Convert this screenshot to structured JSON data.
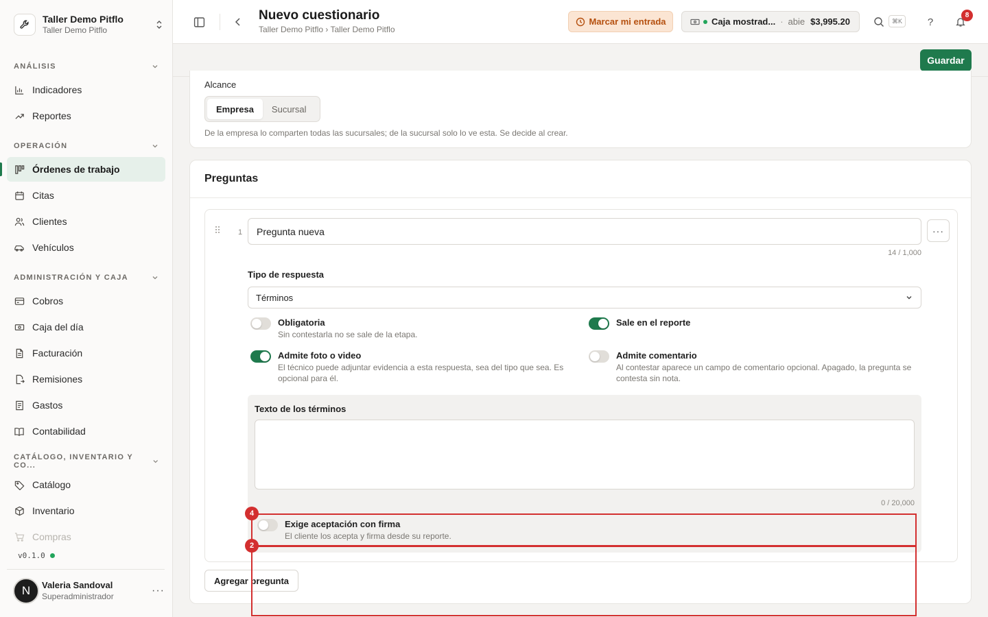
{
  "org": {
    "name": "Taller Demo Pitflo",
    "subtitle": "Taller Demo Pitflo"
  },
  "sidebar": {
    "sections": [
      {
        "title": "ANÁLISIS",
        "items": [
          "Indicadores",
          "Reportes"
        ]
      },
      {
        "title": "OPERACIÓN",
        "items": [
          "Órdenes de trabajo",
          "Citas",
          "Clientes",
          "Vehículos"
        ]
      },
      {
        "title": "ADMINISTRACIÓN Y CAJA",
        "items": [
          "Cobros",
          "Caja del día",
          "Facturación",
          "Remisiones",
          "Gastos",
          "Contabilidad"
        ]
      },
      {
        "title": "CATÁLOGO, INVENTARIO Y CO...",
        "items": [
          "Catálogo",
          "Inventario",
          "Compras"
        ]
      }
    ],
    "version": "v0.1.0"
  },
  "user": {
    "initial": "N",
    "name": "Valeria Sandoval",
    "role": "Superadministrador",
    "more": "···"
  },
  "header": {
    "title": "Nuevo cuestionario",
    "breadcrumb": "Taller Demo Pitflo › Taller Demo Pitflo",
    "checkin_label": "Marcar mi entrada",
    "cash": {
      "name": "Caja mostrad...",
      "sep": "·",
      "status": "abie",
      "amount": "$3,995.20"
    },
    "search_shortcut": "⌘K",
    "help": "?",
    "notifications_count": "8"
  },
  "actions": {
    "save_label": "Guardar"
  },
  "scope": {
    "label": "Alcance",
    "options": [
      "Empresa",
      "Sucursal"
    ],
    "selected": "Empresa",
    "help": "De la empresa lo comparten todas las sucursales; de la sucursal solo lo ve esta. Se decide al crear."
  },
  "questions": {
    "title": "Preguntas",
    "add_label": "Agregar pregunta",
    "items": [
      {
        "number": "1",
        "text": "Pregunta nueva",
        "char_count": "14 / 1,000",
        "more": "···",
        "type_label": "Tipo de respuesta",
        "type_value": "Términos",
        "options": [
          {
            "title": "Obligatoria",
            "desc": "Sin contestarla no se sale de la etapa.",
            "on": false
          },
          {
            "title": "Sale en el reporte",
            "desc": "",
            "on": true
          },
          {
            "title": "Admite foto o video",
            "desc": "El técnico puede adjuntar evidencia a esta respuesta, sea del tipo que sea. Es opcional para él.",
            "on": true
          },
          {
            "title": "Admite comentario",
            "desc": "Al contestar aparece un campo de comentario opcional. Apagado, la pregunta se contesta sin nota.",
            "on": false
          }
        ],
        "terms": {
          "label": "Texto de los términos",
          "value": "",
          "char_count": "0 / 20,000",
          "signature": {
            "title": "Exige aceptación con firma",
            "desc": "El cliente los acepta y firma desde su reporte.",
            "on": false
          }
        }
      }
    ]
  },
  "annotations": {
    "badge_a": "4",
    "badge_b": "2",
    "color": "#d32f2f"
  },
  "colors": {
    "accent": "#1f7a4d",
    "warning_bg": "#fbe5d3",
    "warning_text": "#b5500f",
    "danger": "#d32f2f"
  }
}
